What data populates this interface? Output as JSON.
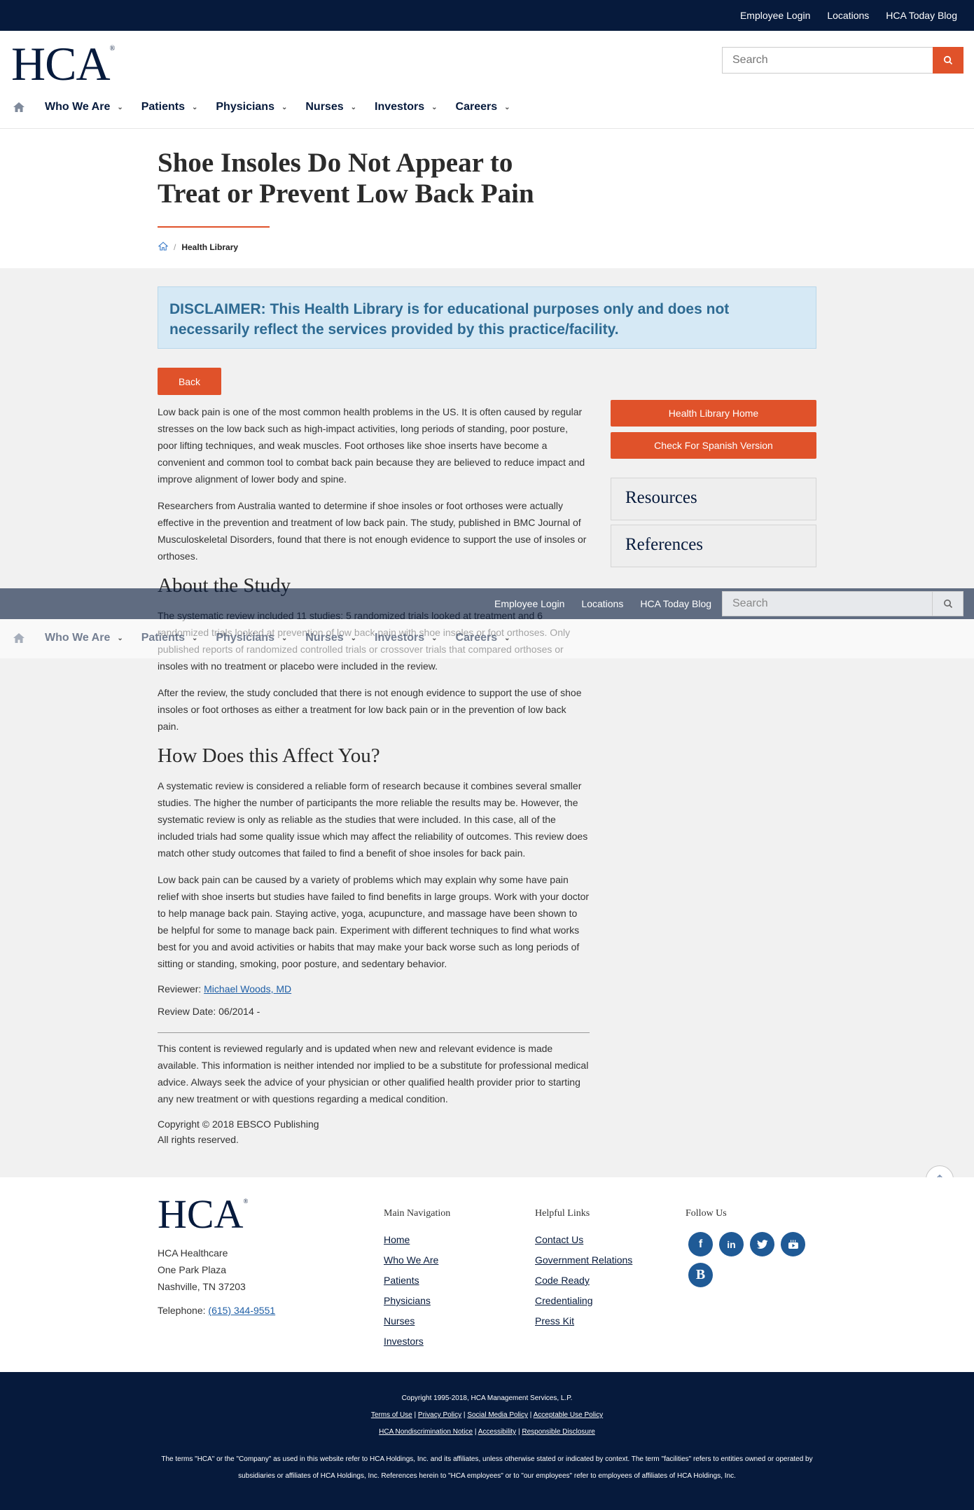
{
  "utility": {
    "employee_login": "Employee Login",
    "locations": "Locations",
    "today_blog": "HCA Today Blog"
  },
  "brand": {
    "logo": "HCA",
    "reg": "®"
  },
  "search": {
    "placeholder": "Search"
  },
  "nav": {
    "items": [
      {
        "label": "Who We Are"
      },
      {
        "label": "Patients"
      },
      {
        "label": "Physicians"
      },
      {
        "label": "Nurses"
      },
      {
        "label": "Investors"
      },
      {
        "label": "Careers"
      }
    ]
  },
  "page": {
    "title": "Shoe Insoles Do Not Appear to Treat or Prevent Low Back Pain",
    "breadcrumb": "Health Library",
    "disclaimer": "DISCLAIMER: This Health Library is for educational purposes only and does not necessarily reflect the services provided by this practice/facility.",
    "back": "Back"
  },
  "article": {
    "p1": "Low back pain is one of the most common health problems in the US. It is often caused by regular stresses on the low back such as high-impact activities, long periods of standing, poor posture, poor lifting techniques, and weak muscles. Foot orthoses like shoe inserts have become a convenient and common tool to combat back pain because they are believed to reduce impact and improve alignment of lower body and spine.",
    "p2": "Researchers from Australia wanted to determine if shoe insoles or foot orthoses were actually effective in the prevention and treatment of low back pain. The study, published in BMC Journal of Musculoskeletal Disorders, found that there is not enough evidence to support the use of insoles or orthoses.",
    "h_about": "About the Study",
    "p3": "The systematic review included 11 studies: 5 randomized trials looked at treatment and 6 randomized trials looked at prevention of low back pain with shoe insoles or foot orthoses. Only published reports of randomized controlled trials or crossover trials that compared orthoses or insoles with no treatment or placebo were included in the review.",
    "p4": "After the review, the study concluded that there is not enough evidence to support the use of shoe insoles or foot orthoses as either a treatment for low back pain or in the prevention of low back pain.",
    "h_affect": "How Does this Affect You?",
    "p5": "A systematic review is considered a reliable form of research because it combines several smaller studies. The higher the number of participants the more reliable the results may be. However, the systematic review is only as reliable as the studies that were included. In this case, all of the included trials had some quality issue which may affect the reliability of outcomes. This review does match other study outcomes that failed to find a benefit of shoe insoles for back pain.",
    "p6": "Low back pain can be caused by a variety of problems which may explain why some have pain relief with shoe inserts but studies have failed to find benefits in large groups. Work with your doctor to help manage back pain. Staying active, yoga, acupuncture, and massage have been shown to be helpful for some to manage back pain. Experiment with different techniques to find what works best for you and avoid activities or habits that may make your back worse such as long periods of sitting or standing, smoking, poor posture, and sedentary behavior.",
    "reviewer_label": "Reviewer:",
    "reviewer_name": "Michael Woods, MD",
    "review_date": "Review Date: 06/2014 -",
    "note": "This content is reviewed regularly and is updated when new and relevant evidence is made available. This information is neither intended nor implied to be a substitute for professional medical advice. Always seek the advice of your physician or other qualified health provider prior to starting any new treatment or with questions regarding a medical condition.",
    "copyright1": "Copyright © 2018 EBSCO Publishing",
    "copyright2": "All rights reserved."
  },
  "sidebar": {
    "home": "Health Library Home",
    "spanish": "Check For Spanish Version",
    "resources": "Resources",
    "references": "References"
  },
  "footer": {
    "org": "HCA Healthcare",
    "addr1": "One Park Plaza",
    "addr2": "Nashville, TN 37203",
    "phone_label": "Telephone:",
    "phone": "(615) 344-9551",
    "main_nav_title": "Main Navigation",
    "main_nav": [
      "Home",
      "Who We Are",
      "Patients",
      "Physicians",
      "Nurses",
      "Investors"
    ],
    "helpful_title": "Helpful Links",
    "helpful": [
      "Contact Us",
      "Government Relations",
      "Code Ready",
      "Credentialing",
      "Press Kit"
    ],
    "follow_title": "Follow Us",
    "social": [
      "f",
      "in",
      "twitter",
      "youtube",
      "B"
    ]
  },
  "legal": {
    "copyright": "Copyright 1995-2018, HCA Management Services, L.P.",
    "links1": [
      "Terms of Use",
      "Privacy Policy",
      "Social Media Policy",
      "Acceptable Use Policy"
    ],
    "links2": [
      "HCA Nondiscrimination Notice",
      "Accessibility",
      "Responsible Disclosure"
    ],
    "terms": "The terms \"HCA\" or the \"Company\" as used in this website refer to HCA Holdings, Inc. and its affiliates, unless otherwise stated or indicated by context. The term \"facilities\" refers to entities owned or operated by subsidiaries or affiliates of HCA Holdings, Inc. References herein to \"HCA employees\" or to \"our employees\" refer to employees of affiliates of HCA Holdings, Inc."
  },
  "colors": {
    "navy": "#061a3c",
    "accent": "#e0522a",
    "link": "#1f5fa6",
    "disclaimer_bg": "#d6e9f5"
  }
}
